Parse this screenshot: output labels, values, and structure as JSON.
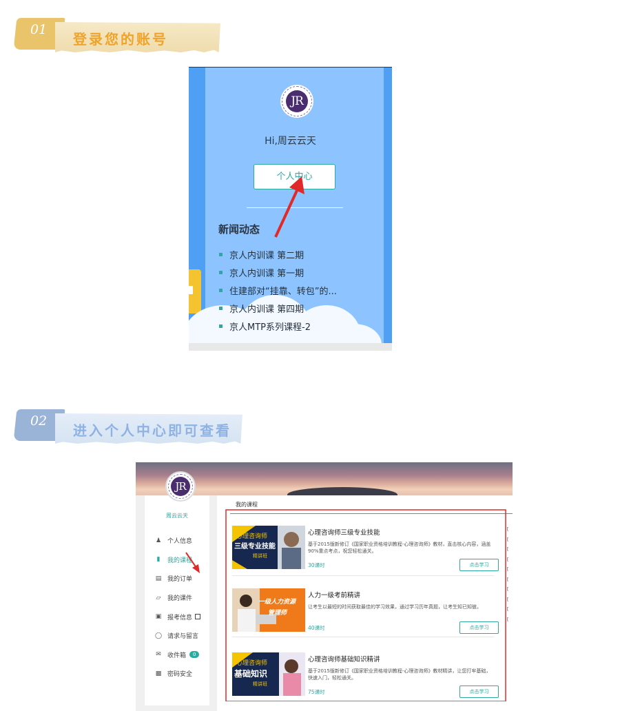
{
  "banners": [
    {
      "num": "01",
      "title": "登录您的账号"
    },
    {
      "num": "02",
      "title": "进入个人中心即可查看"
    }
  ],
  "mobile": {
    "logo_text": "JR",
    "greeting": "Hi,周云云天",
    "center_button": "个人中心",
    "news_title": "新闻动态",
    "news": [
      "京人内训课 第二期",
      "京人内训课 第一期",
      "住建部对“挂靠、转包”的...",
      "京人内训课 第四期",
      "京人MTP系列课程-2"
    ]
  },
  "pc": {
    "logo_text": "JR",
    "username": "周云云天",
    "menu": [
      {
        "label": "个人信息",
        "icon": "user-icon"
      },
      {
        "label": "我的课程",
        "icon": "book-icon",
        "active": true
      },
      {
        "label": "我的订单",
        "icon": "order-icon"
      },
      {
        "label": "我的课件",
        "icon": "folder-icon"
      },
      {
        "label": "报考信息",
        "icon": "card-icon"
      },
      {
        "label": "请求与留言",
        "icon": "chat-icon"
      },
      {
        "label": "收件箱",
        "icon": "mail-icon",
        "badge": "0"
      },
      {
        "label": "密码安全",
        "icon": "lock-icon"
      }
    ],
    "main_title": "我的课程",
    "study_label": "点击学习",
    "courses": [
      {
        "name": "心理咨询师三级专业技能",
        "desc": "基于2015版新修订《国家职业资格培训教程-心理咨询师》教材，直击核心内容，涵盖90%重点考点，祝您轻松通关。",
        "hours": "30课时",
        "thumb_line1": "心理咨询师",
        "thumb_line2": "三级专业技能",
        "thumb_line3": "精讲班"
      },
      {
        "name": "人力一级考前精讲",
        "desc": "让考生以最短的时间获取最佳的学习效果，通过学习历年真题，让考生知已知彼。",
        "hours": "40课时",
        "thumb_line1": "一级人力资源",
        "thumb_line2": "管理师"
      },
      {
        "name": "心理咨询师基础知识精讲",
        "desc": "基于2015版新修订《国家职业资格培训教程-心理咨询师》教材精讲，让您打牢基础，快速入门，轻松通关。",
        "hours": "75课时",
        "thumb_line1": "心理咨询师",
        "thumb_line2": "基础知识",
        "thumb_line3": "精讲班"
      }
    ]
  },
  "colors": {
    "accent": "#2ca9a0",
    "mobile_bg": "#8dc4ff",
    "highlight": "#e02a2a"
  }
}
